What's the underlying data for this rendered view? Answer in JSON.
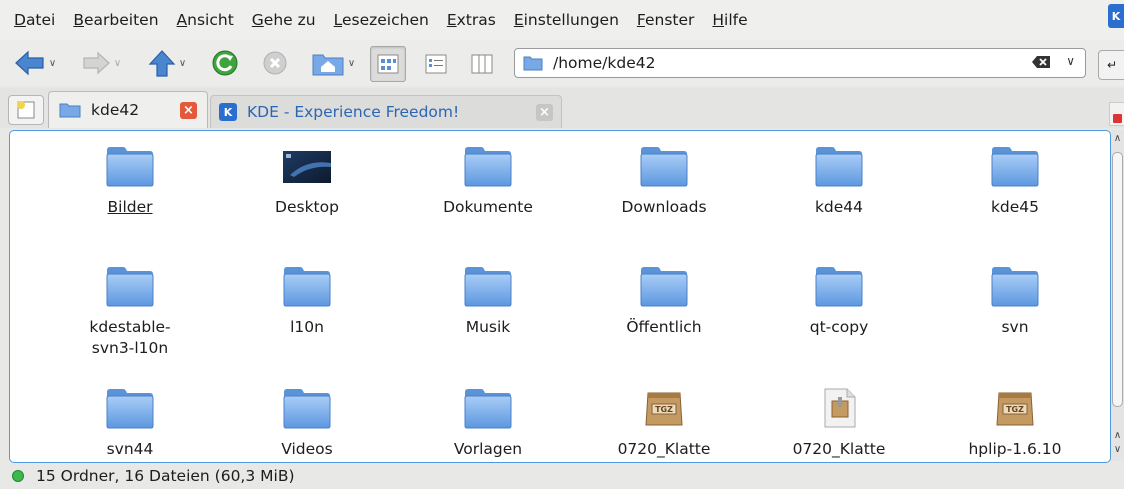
{
  "menubar": {
    "items": [
      {
        "label": "Datei",
        "mnemonic": "D",
        "rest": "atei"
      },
      {
        "label": "Bearbeiten",
        "mnemonic": "B",
        "rest": "earbeiten"
      },
      {
        "label": "Ansicht",
        "mnemonic": "A",
        "rest": "nsicht"
      },
      {
        "label": "Gehe zu",
        "mnemonic": "G",
        "rest": "ehe zu"
      },
      {
        "label": "Lesezeichen",
        "mnemonic": "L",
        "rest": "esezeichen"
      },
      {
        "label": "Extras",
        "mnemonic": "E",
        "rest": "xtras"
      },
      {
        "label": "Einstellungen",
        "mnemonic": "E",
        "rest": "instellungen"
      },
      {
        "label": "Fenster",
        "mnemonic": "F",
        "rest": "enster"
      },
      {
        "label": "Hilfe",
        "mnemonic": "H",
        "rest": "ilfe"
      }
    ]
  },
  "toolbar": {
    "location": "/home/kde42"
  },
  "tabs": [
    {
      "label": "kde42",
      "active": true
    },
    {
      "label": "KDE - Experience Freedom!",
      "active": false
    }
  ],
  "files": [
    {
      "name": "Bilder",
      "type": "folder"
    },
    {
      "name": "Desktop",
      "type": "desktop"
    },
    {
      "name": "Dokumente",
      "type": "folder"
    },
    {
      "name": "Downloads",
      "type": "folder"
    },
    {
      "name": "kde44",
      "type": "folder"
    },
    {
      "name": "kde45",
      "type": "folder"
    },
    {
      "name": "kdestable-\nsvn3-l10n",
      "type": "folder"
    },
    {
      "name": "l10n",
      "type": "folder"
    },
    {
      "name": "Musik",
      "type": "folder"
    },
    {
      "name": "Öffentlich",
      "type": "folder"
    },
    {
      "name": "qt-copy",
      "type": "folder"
    },
    {
      "name": "svn",
      "type": "folder"
    },
    {
      "name": "svn44",
      "type": "folder"
    },
    {
      "name": "Videos",
      "type": "folder"
    },
    {
      "name": "Vorlagen",
      "type": "folder"
    },
    {
      "name": "0720_Klatte",
      "type": "tgz"
    },
    {
      "name": "0720_Klatte",
      "type": "archive"
    },
    {
      "name": "hplip-1.6.10",
      "type": "tgz"
    }
  ],
  "icons": {
    "tgz_label": "TGZ",
    "kde_letter": "K"
  },
  "status": {
    "text": "15 Ordner, 16 Dateien (60,3 MiB)"
  }
}
